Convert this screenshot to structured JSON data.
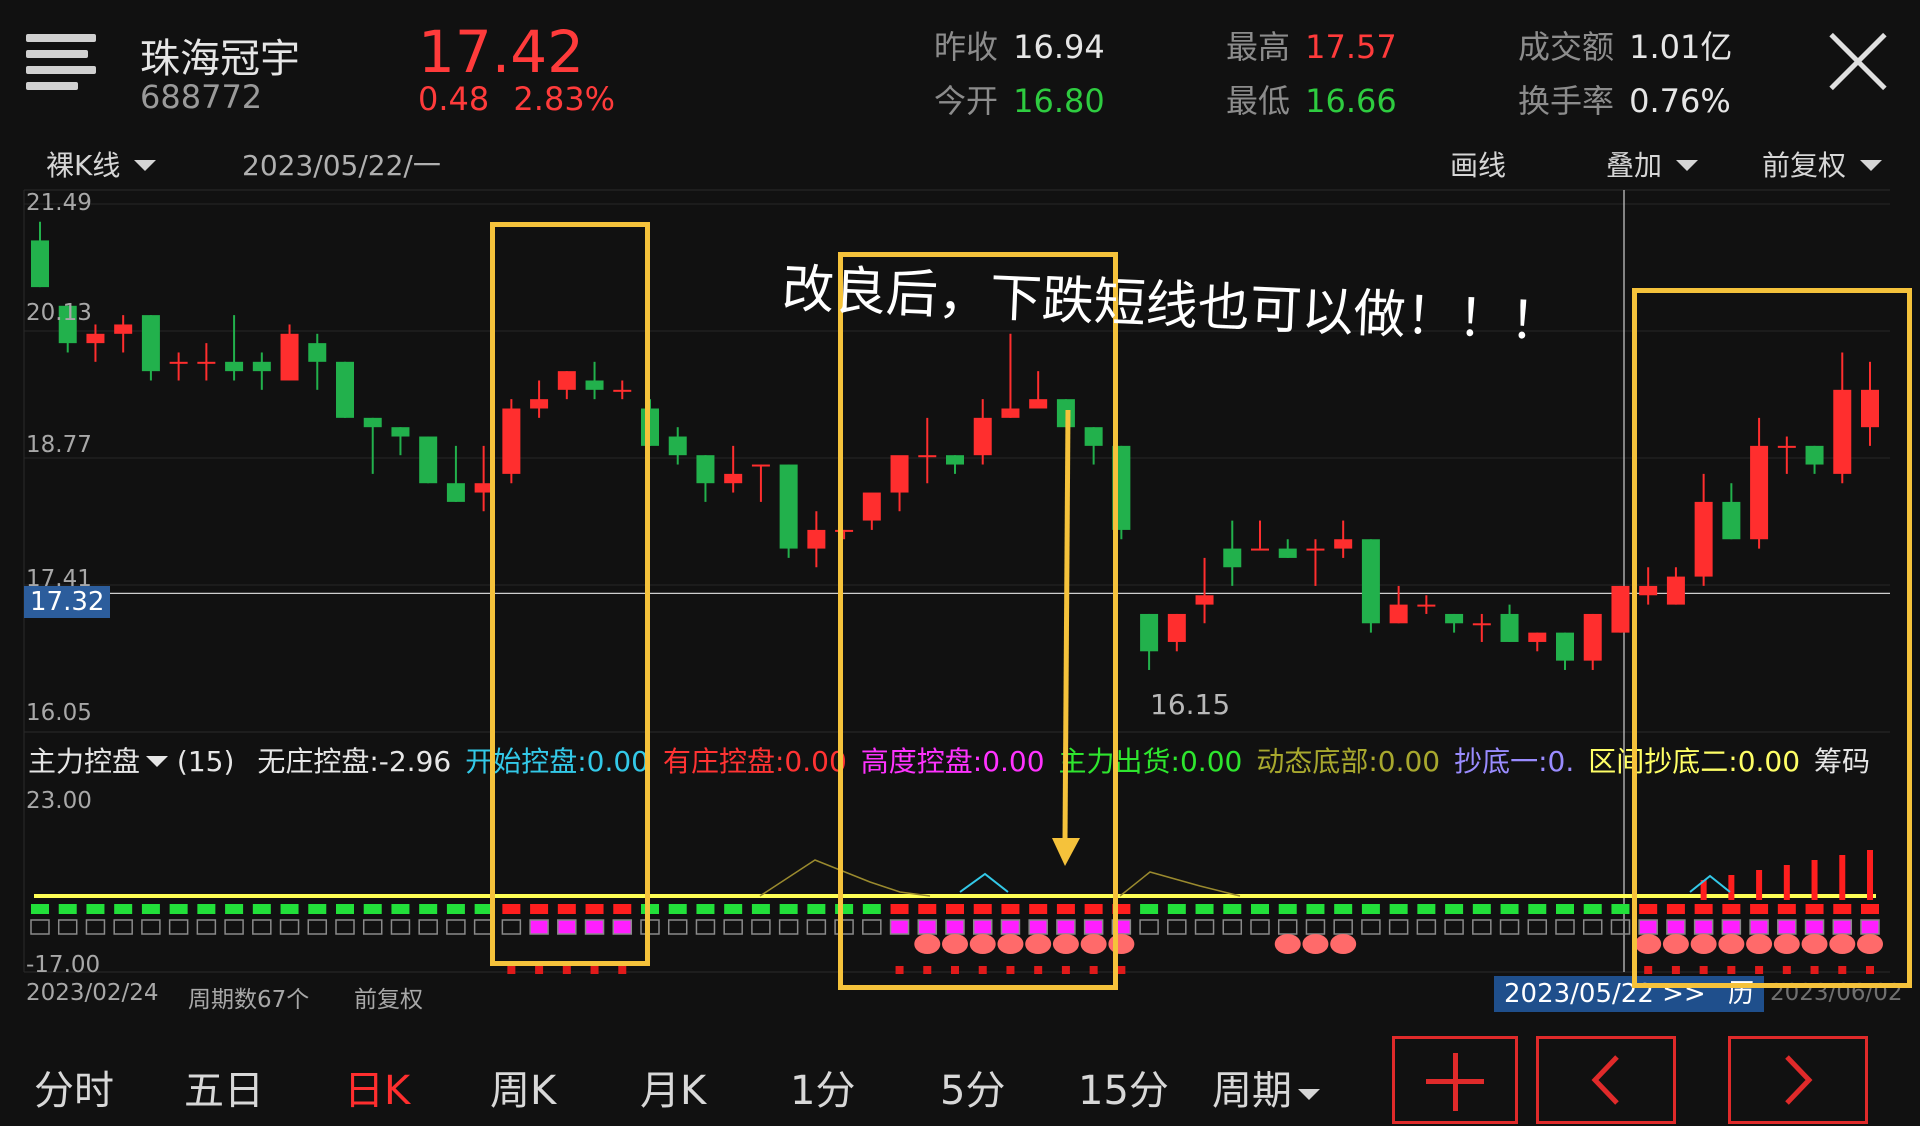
{
  "header": {
    "stock_name": "珠海冠宇",
    "stock_code": "688772",
    "price": "17.42",
    "change": "0.48",
    "change_pct": "2.83%",
    "quotes": {
      "prev_close_label": "昨收",
      "prev_close": "16.94",
      "open_label": "今开",
      "open": "16.80",
      "high_label": "最高",
      "high": "17.57",
      "low_label": "最低",
      "low": "16.66",
      "turnover_label": "成交额",
      "turnover": "1.01亿",
      "rate_label": "换手率",
      "rate": "0.76%"
    }
  },
  "toolbar": {
    "kline_type": "裸K线",
    "date": "2023/05/22/一",
    "draw": "画线",
    "overlay": "叠加",
    "adjust": "前复权"
  },
  "price_axis": {
    "ticks": [
      "21.49",
      "20.13",
      "18.77",
      "17.41",
      "16.05"
    ],
    "crosshair_label": "17.32",
    "low_marker": "16.15"
  },
  "annotation": {
    "text": "改良后，下跌短线也可以做！！！"
  },
  "indicator": {
    "name": "主力控盘",
    "period": "(15)",
    "items": [
      {
        "label": "无庄控盘:",
        "value": "-2.96",
        "color": "#e6e6e6"
      },
      {
        "label": "开始控盘:",
        "value": "0.00",
        "color": "#33c9e8"
      },
      {
        "label": "有庄控盘:",
        "value": "0.00",
        "color": "#ff3333"
      },
      {
        "label": "高度控盘:",
        "value": "0.00",
        "color": "#ff33ff"
      },
      {
        "label": "主力出货:",
        "value": "0.00",
        "color": "#2ee62e"
      },
      {
        "label": "动态底部:",
        "value": "0.00",
        "color": "#a8a82e"
      },
      {
        "label": "抄底一:",
        "value": "0.",
        "color": "#9a8cff"
      },
      {
        "label": "区间抄底二:",
        "value": "0.00",
        "color": "#ffff66"
      },
      {
        "label": "筹码",
        "value": "",
        "color": "#e6e6e6"
      }
    ],
    "ymax": "23.00",
    "ymin": "-17.00"
  },
  "footer_info": {
    "start_date": "2023/02/24",
    "period_count": "周期数67个",
    "adjust": "前复权",
    "current_date": "2023/05/22 >>",
    "history": "历",
    "end_date": "2023/06/02"
  },
  "bottom_tabs": [
    "分时",
    "五日",
    "日K",
    "周K",
    "月K",
    "1分",
    "5分",
    "15分",
    "周期"
  ],
  "bottom_tabs_active": "日K",
  "nav_buttons": {
    "add": "+",
    "prev": "‹",
    "next": "›"
  },
  "colors": {
    "up": "#ff2e2e",
    "down": "#22b14c",
    "annotation_box": "#f5c23b",
    "background": "#111111"
  },
  "chart_data": {
    "type": "candlestick",
    "y_range": [
      16.05,
      21.49
    ],
    "candles": [
      {
        "o": 21.1,
        "h": 21.3,
        "l": 20.6,
        "c": 20.6
      },
      {
        "o": 20.4,
        "h": 20.4,
        "l": 19.9,
        "c": 20.0
      },
      {
        "o": 20.0,
        "h": 20.2,
        "l": 19.8,
        "c": 20.1
      },
      {
        "o": 20.1,
        "h": 20.3,
        "l": 19.9,
        "c": 20.2
      },
      {
        "o": 20.3,
        "h": 20.3,
        "l": 19.6,
        "c": 19.7
      },
      {
        "o": 19.8,
        "h": 19.9,
        "l": 19.6,
        "c": 19.8
      },
      {
        "o": 19.8,
        "h": 20.0,
        "l": 19.6,
        "c": 19.8
      },
      {
        "o": 19.8,
        "h": 20.3,
        "l": 19.6,
        "c": 19.7
      },
      {
        "o": 19.8,
        "h": 19.9,
        "l": 19.5,
        "c": 19.7
      },
      {
        "o": 19.6,
        "h": 20.2,
        "l": 19.6,
        "c": 20.1
      },
      {
        "o": 20.0,
        "h": 20.1,
        "l": 19.5,
        "c": 19.8
      },
      {
        "o": 19.8,
        "h": 19.8,
        "l": 19.2,
        "c": 19.2
      },
      {
        "o": 19.2,
        "h": 19.2,
        "l": 18.6,
        "c": 19.1
      },
      {
        "o": 19.1,
        "h": 19.1,
        "l": 18.8,
        "c": 19.0
      },
      {
        "o": 19.0,
        "h": 19.0,
        "l": 18.5,
        "c": 18.5
      },
      {
        "o": 18.5,
        "h": 18.9,
        "l": 18.3,
        "c": 18.3
      },
      {
        "o": 18.4,
        "h": 18.9,
        "l": 18.2,
        "c": 18.5
      },
      {
        "o": 18.6,
        "h": 19.4,
        "l": 18.5,
        "c": 19.3
      },
      {
        "o": 19.3,
        "h": 19.6,
        "l": 19.2,
        "c": 19.4
      },
      {
        "o": 19.5,
        "h": 19.7,
        "l": 19.4,
        "c": 19.7
      },
      {
        "o": 19.6,
        "h": 19.8,
        "l": 19.4,
        "c": 19.5
      },
      {
        "o": 19.5,
        "h": 19.6,
        "l": 19.4,
        "c": 19.5
      },
      {
        "o": 19.3,
        "h": 19.4,
        "l": 18.9,
        "c": 18.9
      },
      {
        "o": 19.0,
        "h": 19.1,
        "l": 18.7,
        "c": 18.8
      },
      {
        "o": 18.8,
        "h": 18.8,
        "l": 18.3,
        "c": 18.5
      },
      {
        "o": 18.5,
        "h": 18.9,
        "l": 18.4,
        "c": 18.6
      },
      {
        "o": 18.7,
        "h": 18.7,
        "l": 18.3,
        "c": 18.7
      },
      {
        "o": 18.7,
        "h": 18.7,
        "l": 17.7,
        "c": 17.8
      },
      {
        "o": 17.8,
        "h": 18.2,
        "l": 17.6,
        "c": 18.0
      },
      {
        "o": 18.0,
        "h": 18.0,
        "l": 17.9,
        "c": 18.0
      },
      {
        "o": 18.1,
        "h": 18.3,
        "l": 18.0,
        "c": 18.4
      },
      {
        "o": 18.4,
        "h": 18.7,
        "l": 18.2,
        "c": 18.8
      },
      {
        "o": 18.8,
        "h": 19.2,
        "l": 18.5,
        "c": 18.8
      },
      {
        "o": 18.8,
        "h": 18.8,
        "l": 18.6,
        "c": 18.7
      },
      {
        "o": 18.8,
        "h": 19.4,
        "l": 18.7,
        "c": 19.2
      },
      {
        "o": 19.2,
        "h": 20.1,
        "l": 19.2,
        "c": 19.3
      },
      {
        "o": 19.3,
        "h": 19.7,
        "l": 19.3,
        "c": 19.4
      },
      {
        "o": 19.4,
        "h": 19.4,
        "l": 19.1,
        "c": 19.1
      },
      {
        "o": 19.1,
        "h": 19.1,
        "l": 18.7,
        "c": 18.9
      },
      {
        "o": 18.9,
        "h": 18.9,
        "l": 17.9,
        "c": 18.0
      },
      {
        "o": 17.1,
        "h": 17.1,
        "l": 16.5,
        "c": 16.7
      },
      {
        "o": 16.8,
        "h": 17.1,
        "l": 16.7,
        "c": 17.1
      },
      {
        "o": 17.2,
        "h": 17.7,
        "l": 17.0,
        "c": 17.3
      },
      {
        "o": 17.8,
        "h": 18.1,
        "l": 17.4,
        "c": 17.6
      },
      {
        "o": 17.8,
        "h": 18.1,
        "l": 17.8,
        "c": 17.8
      },
      {
        "o": 17.8,
        "h": 17.9,
        "l": 17.7,
        "c": 17.7
      },
      {
        "o": 17.8,
        "h": 17.9,
        "l": 17.4,
        "c": 17.8
      },
      {
        "o": 17.8,
        "h": 18.1,
        "l": 17.7,
        "c": 17.9
      },
      {
        "o": 17.9,
        "h": 17.9,
        "l": 16.9,
        "c": 17.0
      },
      {
        "o": 17.0,
        "h": 17.4,
        "l": 17.0,
        "c": 17.2
      },
      {
        "o": 17.2,
        "h": 17.3,
        "l": 17.1,
        "c": 17.2
      },
      {
        "o": 17.1,
        "h": 17.1,
        "l": 16.9,
        "c": 17.0
      },
      {
        "o": 17.0,
        "h": 17.1,
        "l": 16.8,
        "c": 17.0
      },
      {
        "o": 17.1,
        "h": 17.2,
        "l": 16.8,
        "c": 16.8
      },
      {
        "o": 16.8,
        "h": 16.9,
        "l": 16.7,
        "c": 16.9
      },
      {
        "o": 16.9,
        "h": 16.9,
        "l": 16.5,
        "c": 16.6
      },
      {
        "o": 16.6,
        "h": 17.1,
        "l": 16.5,
        "c": 17.1
      },
      {
        "o": 16.9,
        "h": 17.4,
        "l": 16.9,
        "c": 17.4
      },
      {
        "o": 17.3,
        "h": 17.6,
        "l": 17.2,
        "c": 17.4
      },
      {
        "o": 17.2,
        "h": 17.6,
        "l": 17.2,
        "c": 17.5
      },
      {
        "o": 17.5,
        "h": 18.6,
        "l": 17.4,
        "c": 18.3
      },
      {
        "o": 18.3,
        "h": 18.5,
        "l": 17.9,
        "c": 17.9
      },
      {
        "o": 17.9,
        "h": 19.2,
        "l": 17.8,
        "c": 18.9
      },
      {
        "o": 18.9,
        "h": 19.0,
        "l": 18.6,
        "c": 18.9
      },
      {
        "o": 18.9,
        "h": 18.9,
        "l": 18.6,
        "c": 18.7
      },
      {
        "o": 18.6,
        "h": 19.9,
        "l": 18.5,
        "c": 19.5
      },
      {
        "o": 19.1,
        "h": 19.8,
        "l": 18.9,
        "c": 19.5
      }
    ]
  }
}
